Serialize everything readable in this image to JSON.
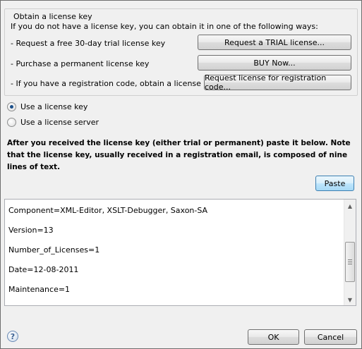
{
  "group": {
    "title": "Obtain a license key",
    "intro": "If you do not have a license key, you can obtain it in one of the following ways:",
    "rows": [
      {
        "text": "- Request a free 30-day trial license key",
        "button": "Request a TRIAL license..."
      },
      {
        "text": "- Purchase a permanent license key",
        "button": "BUY Now..."
      },
      {
        "text": "- If you have a registration code, obtain a license key",
        "button": "Request license for registration code..."
      }
    ]
  },
  "options": {
    "use_key": {
      "label": "Use a license key",
      "selected": true
    },
    "use_server": {
      "label": "Use a license server",
      "selected": false
    }
  },
  "instructions": "After you received the license key (either trial or permanent) paste it below. Note that the license key, usually received in a registration email, is composed of nine lines of text.",
  "paste_label": "Paste",
  "license_text": {
    "lines": [
      "Component=XML-Editor, XSLT-Debugger, Saxon-SA",
      "Version=13",
      "Number_of_Licenses=1",
      "Date=12-08-2011",
      "Maintenance=1"
    ]
  },
  "footer": {
    "help_icon": "help-icon",
    "help_glyph": "?",
    "ok_label": "OK",
    "cancel_label": "Cancel"
  }
}
